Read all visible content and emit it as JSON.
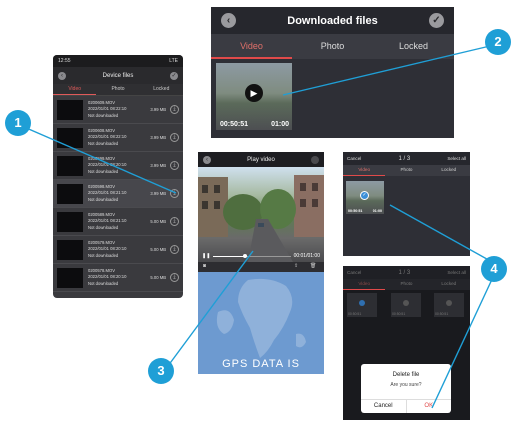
{
  "device_files": {
    "status_time": "12:55",
    "status_right": "LTE",
    "title": "Device files",
    "tabs": [
      "Video",
      "Photo",
      "Locked"
    ],
    "files": [
      {
        "name": "0200609.MOV",
        "datetime": "2022/01/01 08:22:10",
        "size": "3.99 MB",
        "status": "Not downloaded"
      },
      {
        "name": "0200608.MOV",
        "datetime": "2022/01/01 08:22:10",
        "size": "3.99 MB",
        "status": "Not downloaded"
      },
      {
        "name": "0200599.MOV",
        "datetime": "2022/01/01 08:20:10",
        "size": "3.99 MB",
        "status": "Not downloaded"
      },
      {
        "name": "0200598.MOV",
        "datetime": "2022/01/01 08:21:10",
        "size": "3.99 MB",
        "status": "Not downloaded"
      },
      {
        "name": "0200589.MOV",
        "datetime": "2022/01/01 08:21:10",
        "size": "5.00 MB",
        "status": "Not downloaded"
      },
      {
        "name": "0200579.MOV",
        "datetime": "2022/01/01 08:20:10",
        "size": "5.00 MB",
        "status": "Not downloaded"
      },
      {
        "name": "0200578.MOV",
        "datetime": "2022/01/01 08:20:10",
        "size": "5.00 MB",
        "status": "Not downloaded"
      }
    ]
  },
  "downloaded_files": {
    "title": "Downloaded files",
    "tabs": [
      "Video",
      "Photo",
      "Locked"
    ],
    "thumb_time": "00:50:51",
    "thumb_duration": "01:00"
  },
  "play_video": {
    "title": "Play video",
    "time": "00:01/01:00",
    "map_text": "GPS DATA IS"
  },
  "select_screen": {
    "cancel": "Cancel",
    "counter": "1 / 3",
    "select_all": "Select all",
    "tabs": [
      "Video",
      "Photo",
      "Locked"
    ],
    "thumb_time": "00:50:51",
    "thumb_duration": "01:00"
  },
  "delete_screen": {
    "cancel": "Cancel",
    "counter": "1 / 3",
    "select_all": "Select all",
    "tabs": [
      "Video",
      "Photo",
      "Locked"
    ],
    "ghost_times": [
      "00:50:51",
      "00:50:51",
      "00:50:51"
    ],
    "dialog_title": "Delete file",
    "dialog_message": "Are you sure?",
    "dialog_cancel": "Cancel",
    "dialog_ok": "OK"
  },
  "callouts": [
    "1",
    "2",
    "3",
    "4"
  ],
  "colors": {
    "accent": "#e04a4a",
    "callout": "#1f9fd6",
    "line": "#1f9fd6"
  }
}
